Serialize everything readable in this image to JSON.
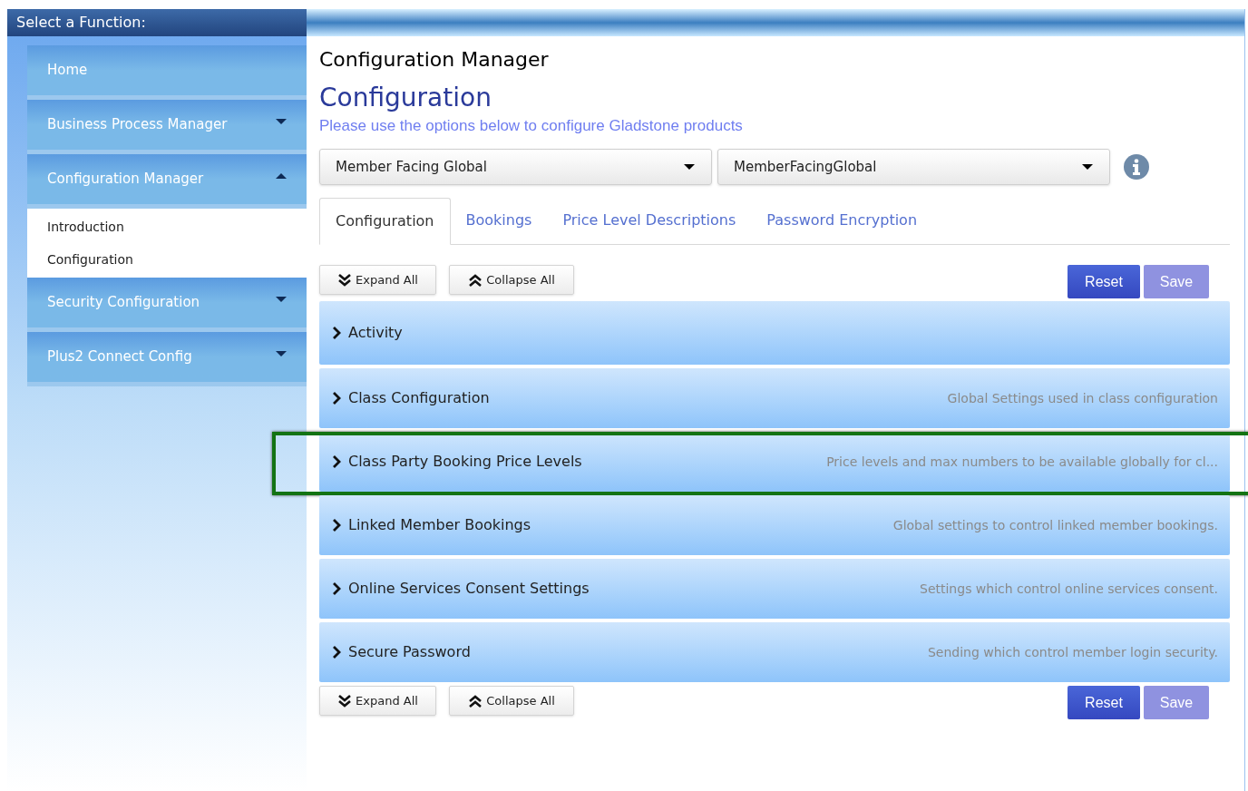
{
  "sidebar": {
    "title": "Select a Function:",
    "items": [
      {
        "label": "Home",
        "kind": "link"
      },
      {
        "label": "Business Process Manager",
        "kind": "menu",
        "expanded": false
      },
      {
        "label": "Configuration Manager",
        "kind": "menu",
        "expanded": true,
        "children": [
          {
            "label": "Introduction"
          },
          {
            "label": "Configuration"
          }
        ]
      },
      {
        "label": "Security Configuration",
        "kind": "menu",
        "expanded": false
      },
      {
        "label": "Plus2 Connect Config",
        "kind": "menu",
        "expanded": false
      }
    ]
  },
  "page": {
    "title": "Configuration Manager",
    "heading": "Configuration",
    "subtitle": "Please use the options below to configure Gladstone products"
  },
  "selects": [
    {
      "value": "Member Facing Global"
    },
    {
      "value": "MemberFacingGlobal"
    }
  ],
  "tabs": [
    {
      "label": "Configuration",
      "selected": true
    },
    {
      "label": "Bookings",
      "selected": false
    },
    {
      "label": "Price Level Descriptions",
      "selected": false
    },
    {
      "label": "Password Encryption",
      "selected": false
    }
  ],
  "toolbar_top": {
    "expand": "Expand All",
    "collapse": "Collapse All",
    "reset": "Reset",
    "save": "Save",
    "save_disabled": true
  },
  "sections": [
    {
      "title": "Activity",
      "highlighted": false
    },
    {
      "title": "Class Configuration",
      "description": "Global Settings used in class configuration",
      "highlighted": false
    },
    {
      "title": "Class Party Booking Price Levels",
      "description": "Price levels and max numbers to be available globally for cl...",
      "highlighted": true
    },
    {
      "title": "Linked Member Bookings",
      "description": "Global settings to control linked member bookings.",
      "highlighted": false
    },
    {
      "title": "Online Services Consent Settings",
      "description": "Settings which control online services consent.",
      "highlighted": false
    },
    {
      "title": "Secure Password",
      "description": "Sending which control member login security.",
      "highlighted": false
    }
  ],
  "toolbar_bottom": {
    "expand": "Expand All",
    "collapse": "Collapse All",
    "reset": "Reset",
    "save": "Save",
    "save_disabled": true
  }
}
